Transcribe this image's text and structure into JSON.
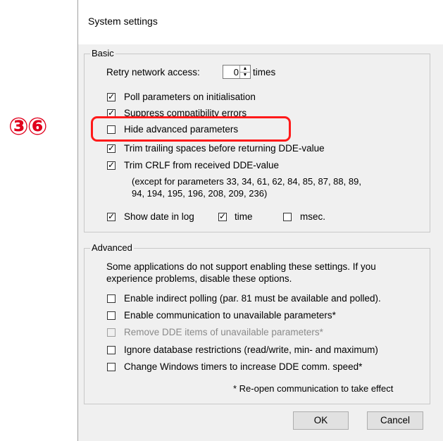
{
  "annotation": {
    "marker": "③⑥"
  },
  "dialog": {
    "title": "System settings",
    "basic": {
      "label": "Basic",
      "retry_label": "Retry network access:",
      "retry_value": "0",
      "retry_unit": "times",
      "options": [
        {
          "label": "Poll parameters on initialisation",
          "checked": true
        },
        {
          "label": "Suppress compatibility errors",
          "checked": true
        },
        {
          "label": "Hide advanced parameters",
          "checked": false
        },
        {
          "label": "Trim trailing spaces before returning DDE-value",
          "checked": true
        },
        {
          "label": "Trim CRLF from received DDE-value",
          "checked": true
        }
      ],
      "crlf_note_line1": "(except for parameters 33, 34, 61, 62, 84, 85, 87, 88, 89,",
      "crlf_note_line2": "94, 194, 195, 196, 208, 209, 236)",
      "show_date_label": "Show date in log",
      "time_label": "time",
      "msec_label": "msec."
    },
    "advanced": {
      "label": "Advanced",
      "desc_line1": "Some applications do not support enabling these settings. If you",
      "desc_line2": "experience problems, disable these options.",
      "options": [
        {
          "label": "Enable indirect polling (par. 81 must be available and polled).",
          "checked": false,
          "enabled": true
        },
        {
          "label": "Enable communication to unavailable parameters*",
          "checked": false,
          "enabled": true
        },
        {
          "label": "Remove DDE items of unavailable parameters*",
          "checked": false,
          "enabled": false
        },
        {
          "label": "Ignore database restrictions (read/write, min- and maximum)",
          "checked": false,
          "enabled": true
        },
        {
          "label": "Change Windows timers to increase DDE comm. speed*",
          "checked": false,
          "enabled": true
        }
      ],
      "footnote": "* Re-open communication to take effect"
    },
    "buttons": {
      "ok": "OK",
      "cancel": "Cancel"
    }
  }
}
